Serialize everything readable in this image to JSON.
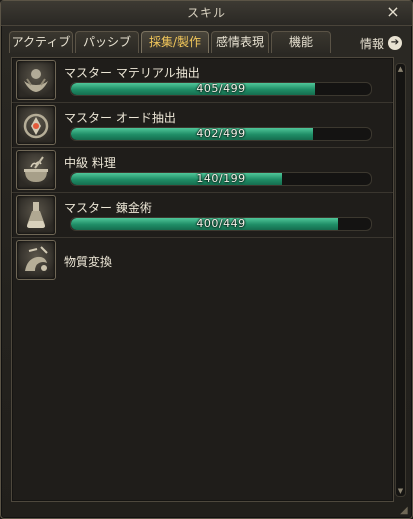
{
  "window": {
    "title": "スキル",
    "close_label": "×"
  },
  "tabs": [
    {
      "label": "アクティブ",
      "active": false
    },
    {
      "label": "パッシブ",
      "active": false
    },
    {
      "label": "採集/製作",
      "active": true
    },
    {
      "label": "感情表現",
      "active": false
    },
    {
      "label": "機能",
      "active": false
    }
  ],
  "info_button": {
    "label": "情報",
    "icon": "arrow-right-icon"
  },
  "skills": [
    {
      "name": "マスター マテリアル抽出",
      "icon": "hands-orb-icon",
      "current": 405,
      "max": 499,
      "progress_text": "405/499"
    },
    {
      "name": "マスター オード抽出",
      "icon": "crystal-orb-icon",
      "current": 402,
      "max": 499,
      "progress_text": "402/499"
    },
    {
      "name": "中級 料理",
      "icon": "cooking-pot-icon",
      "current": 140,
      "max": 199,
      "progress_text": "140/199"
    },
    {
      "name": "マスター 錬金術",
      "icon": "flask-icon",
      "current": 400,
      "max": 449,
      "progress_text": "400/449"
    },
    {
      "name": "物質変換",
      "icon": "hand-transmute-icon"
    }
  ],
  "colors": {
    "bar_fill": "#1f8d66",
    "active_tab_text": "#f1c65a"
  }
}
